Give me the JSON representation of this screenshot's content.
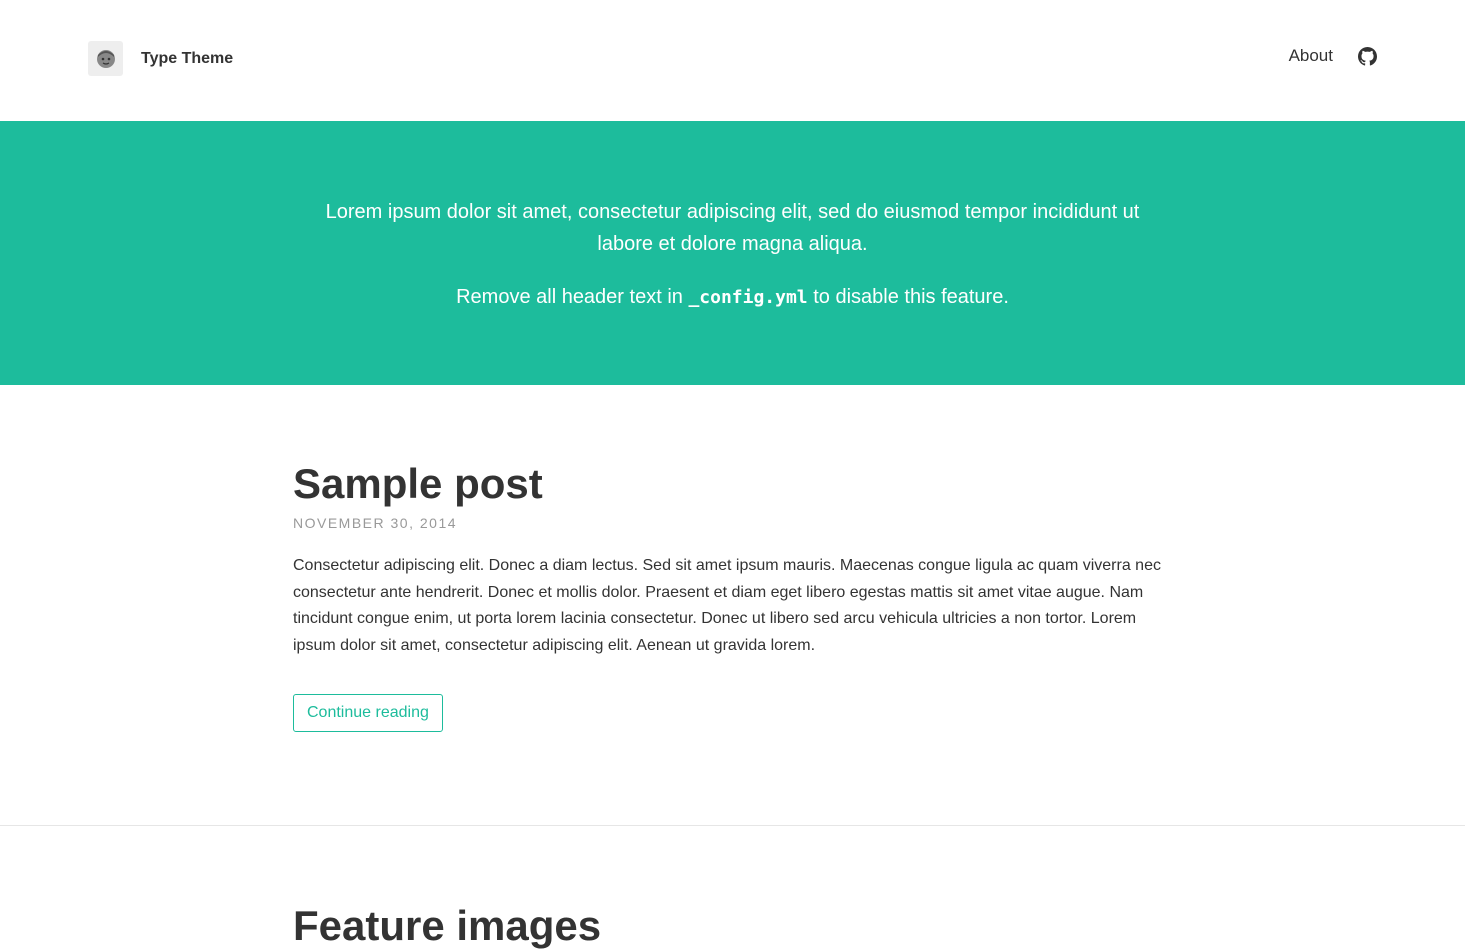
{
  "header": {
    "site_title": "Type Theme",
    "avatar_icon": "avatar-face-icon",
    "nav": {
      "about_label": "About",
      "github_icon": "github-icon"
    }
  },
  "hero": {
    "line1": "Lorem ipsum dolor sit amet, consectetur adipiscing elit, sed do eiusmod tempor incididunt ut labore et dolore magna aliqua.",
    "line2_before": "Remove all header text in ",
    "line2_code": "_config.yml",
    "line2_after": " to disable this feature.",
    "background_color": "#1dbc9c"
  },
  "posts": [
    {
      "title": "Sample post",
      "date": "NOVEMBER 30, 2014",
      "excerpt": "Consectetur adipiscing elit. Donec a diam lectus. Sed sit amet ipsum mauris. Maecenas congue ligula ac quam viverra nec consectetur ante hendrerit. Donec et mollis dolor. Praesent et diam eget libero egestas mattis sit amet vitae augue. Nam tincidunt congue enim, ut porta lorem lacinia consectetur. Donec ut libero sed arcu vehicula ultricies a non tortor. Lorem ipsum dolor sit amet, consectetur adipiscing elit. Aenean ut gravida lorem.",
      "button_label": "Continue reading"
    },
    {
      "title": "Feature images"
    }
  ],
  "colors": {
    "accent": "#1dbc9c",
    "text": "#333333",
    "muted": "#999999"
  }
}
